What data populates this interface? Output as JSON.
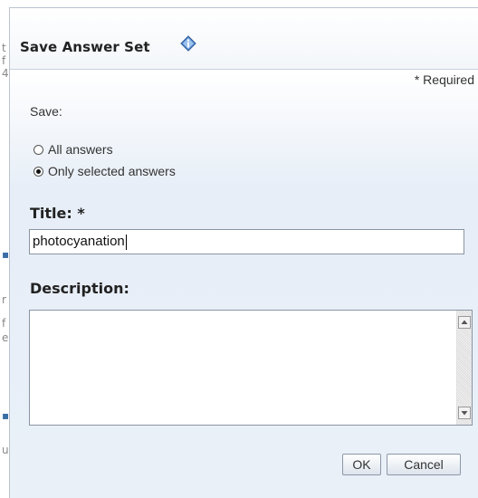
{
  "dialog": {
    "title": "Save Answer Set",
    "info_icon": "info-diamond-icon",
    "required_note": "* Required",
    "save_label": "Save:",
    "radio_options": [
      {
        "label": "All answers",
        "checked": false
      },
      {
        "label": "Only selected answers",
        "checked": true
      }
    ],
    "title_label": "Title: *",
    "title_value": "photocyanation",
    "description_label": "Description:",
    "description_value": "",
    "buttons": {
      "ok": "OK",
      "cancel": "Cancel"
    }
  },
  "background": {
    "fragments": [
      "t",
      "f",
      "4",
      "r",
      "f",
      "e",
      "u"
    ]
  }
}
